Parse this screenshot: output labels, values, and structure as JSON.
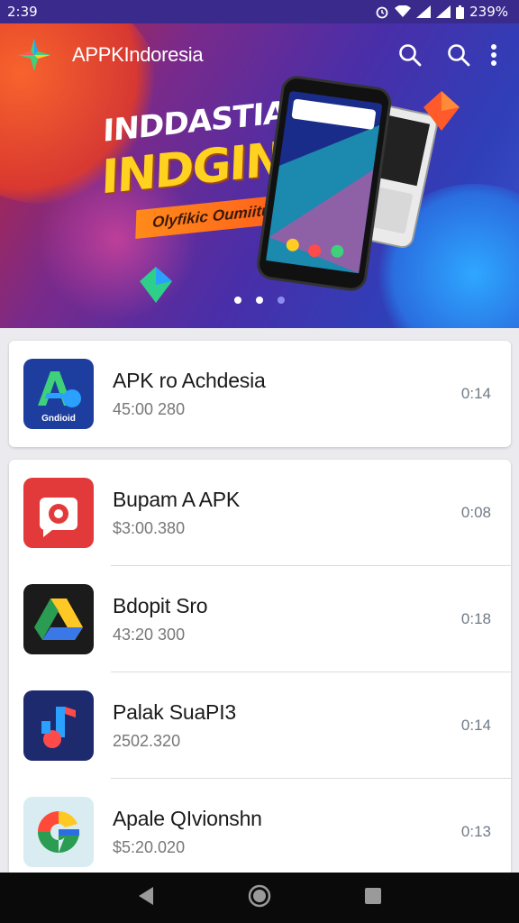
{
  "status_bar": {
    "time": "2:39",
    "right_text": "239%"
  },
  "app_bar": {
    "title": "APPKIndoresia"
  },
  "banner": {
    "headline_1": "INDDASTIA AK",
    "headline_2": "INDGINISIA",
    "ribbon": "Olyfikic Oumiitutui"
  },
  "apps": [
    {
      "name": "APK ro Achdesia",
      "sub": "45:00 280",
      "time": "0:14",
      "icon": "android-a-icon",
      "icon_caption": "Gndioid"
    },
    {
      "name": "Bupam A APK",
      "sub": "$3:00.380",
      "time": "0:08",
      "icon": "red-camera-icon"
    },
    {
      "name": "Bdopit Sro",
      "sub": "43:20 300",
      "time": "0:18",
      "icon": "drive-triangle-icon"
    },
    {
      "name": "Palak SuaPI3",
      "sub": "2502.320",
      "time": "0:14",
      "icon": "music-note-icon"
    },
    {
      "name": "Apale QIvionshn",
      "sub": "$5:20.020",
      "time": "0:13",
      "icon": "colorful-g-icon"
    }
  ],
  "colors": {
    "accent": "#4a2ea8",
    "banner_yellow": "#ffd21f"
  }
}
